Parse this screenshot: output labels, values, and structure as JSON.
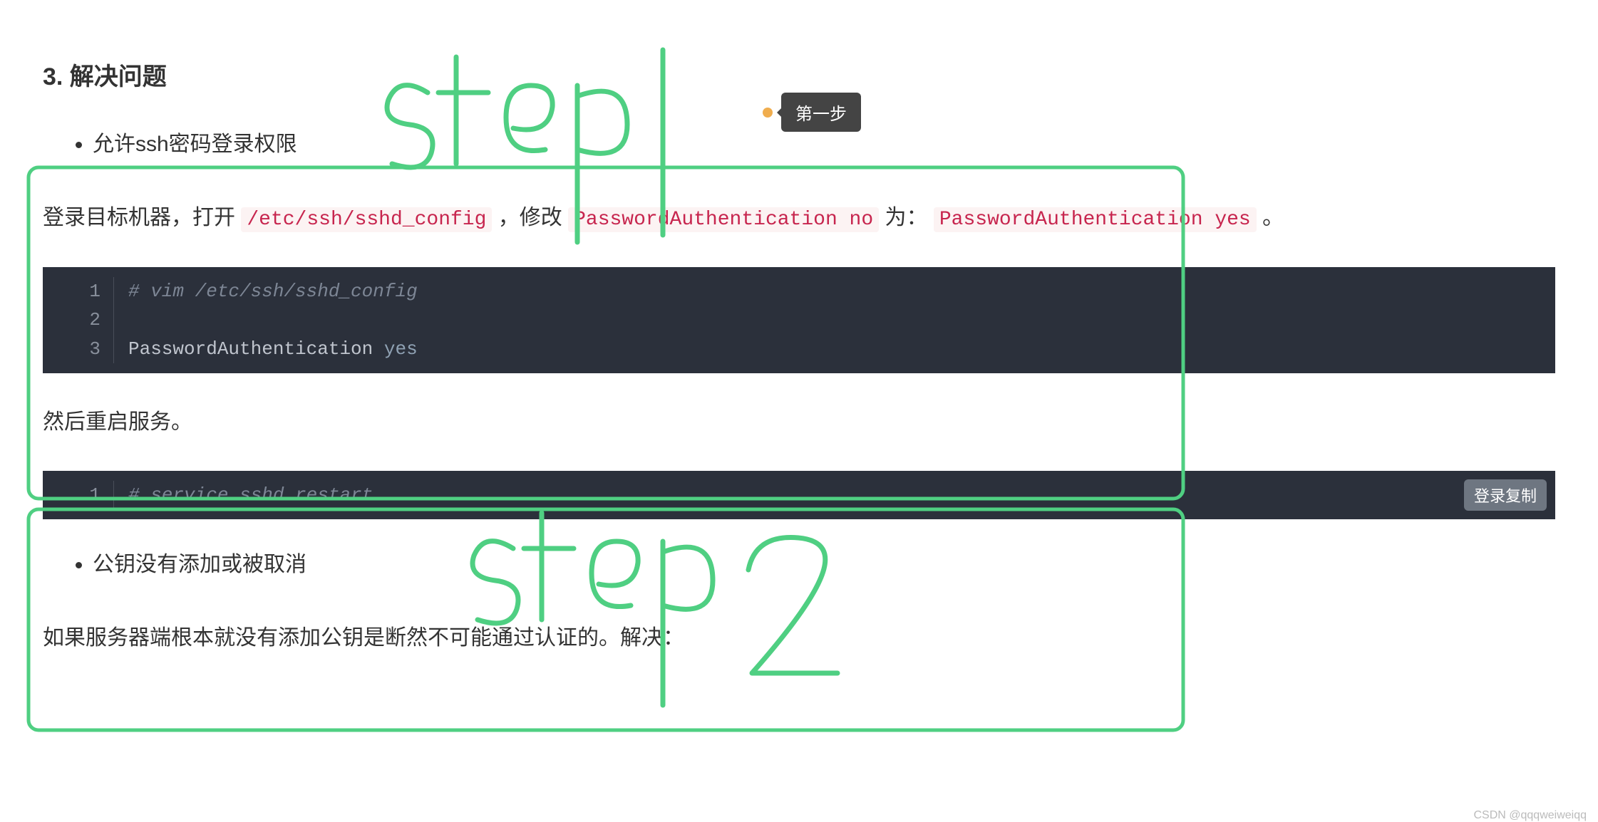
{
  "heading": "3. 解决问题",
  "bullet1": "允许ssh密码登录权限",
  "para1_before": "登录目标机器，打开 ",
  "code_path": "/etc/ssh/sshd_config",
  "para1_mid": " ，修改 ",
  "code_orig": "PasswordAuthentication no",
  "para1_mid2": " 为：",
  "code_new": "PasswordAuthentication yes",
  "para1_end": " 。",
  "codeblock1": {
    "lines": [
      {
        "n": "1",
        "comment": "# vim /etc/ssh/sshd_config"
      },
      {
        "n": "2",
        "blank": true
      },
      {
        "n": "3",
        "key": "PasswordAuthentication ",
        "val": "yes"
      }
    ]
  },
  "para2": "然后重启服务。",
  "codeblock2": {
    "lines": [
      {
        "n": "1",
        "comment": "# service sshd restart"
      }
    ],
    "copy_label": "登录复制"
  },
  "bullet2": "公钥没有添加或被取消",
  "para3": "如果服务器端根本就没有添加公钥是断然不可能通过认证的。解决：",
  "tooltip": "第一步",
  "hand1": "step1",
  "hand2": "step2",
  "watermark": "CSDN @qqqweiweiqq"
}
